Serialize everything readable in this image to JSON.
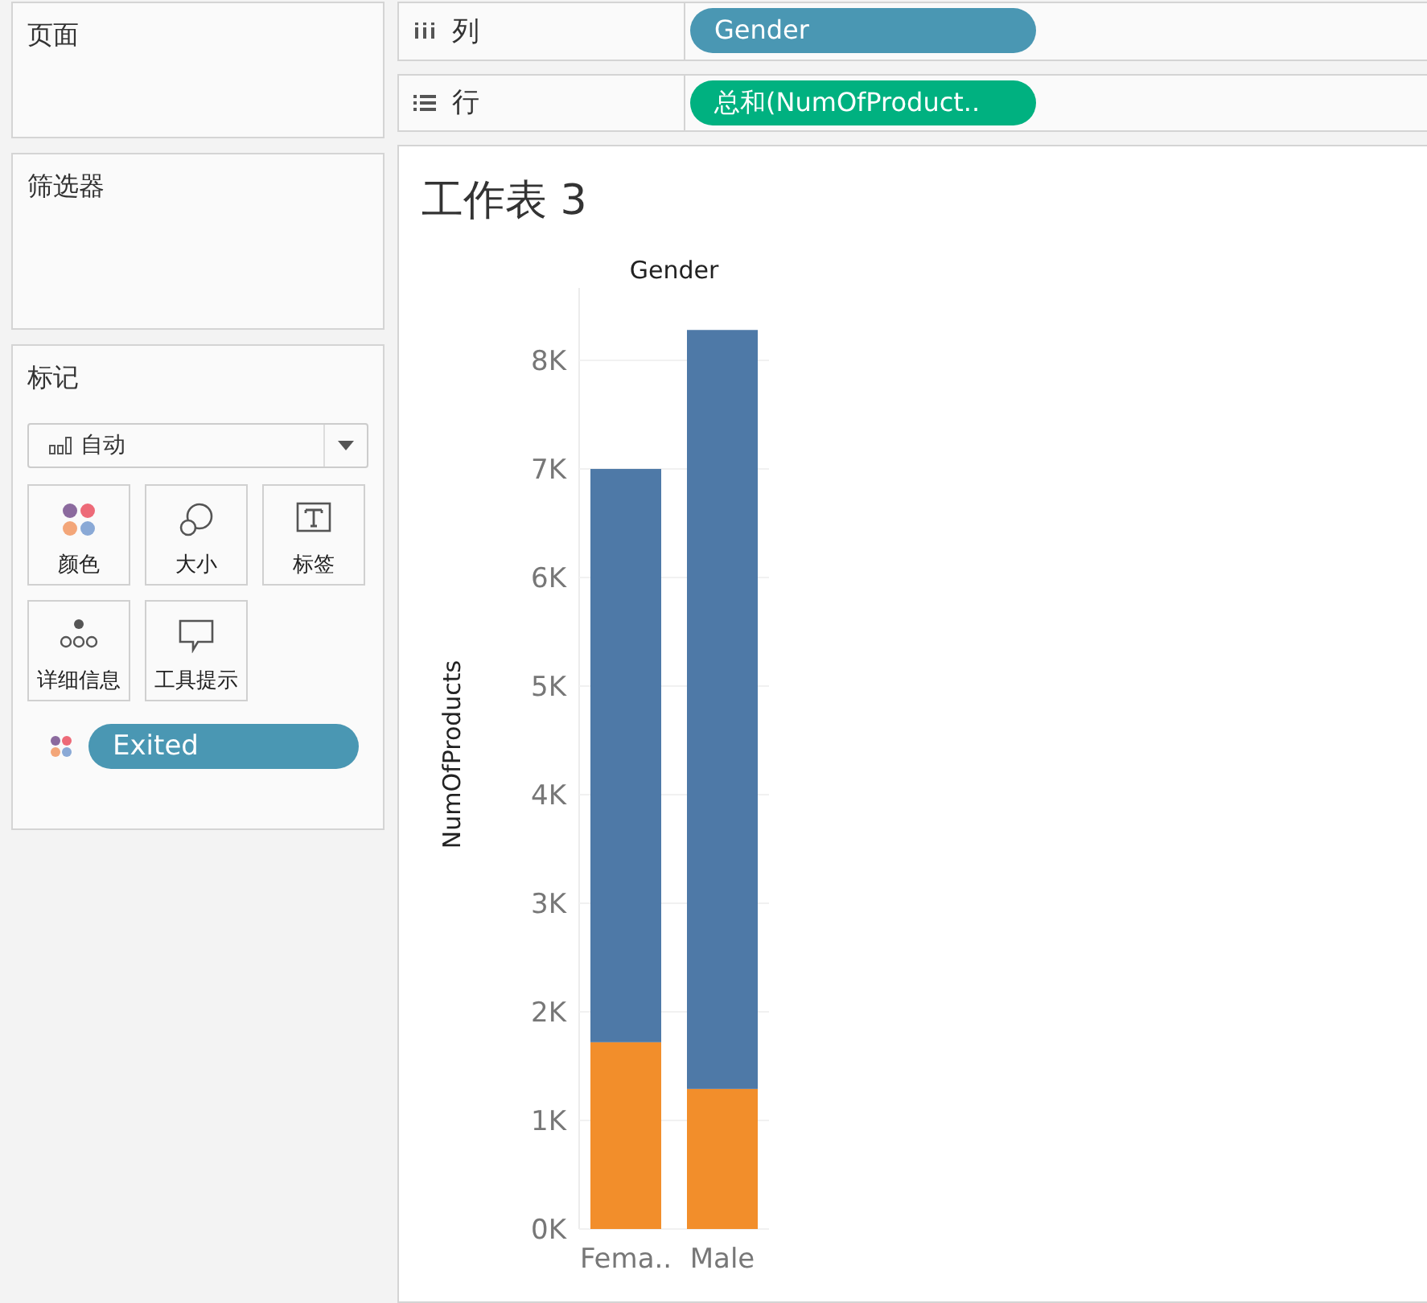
{
  "pages_card": {
    "title": "页面"
  },
  "filters_card": {
    "title": "筛选器"
  },
  "marks_card": {
    "title": "标记",
    "mark_type": "自动",
    "buttons": [
      {
        "kind": "color",
        "label": "颜色"
      },
      {
        "kind": "size",
        "label": "大小"
      },
      {
        "kind": "label",
        "label": "标签"
      },
      {
        "kind": "detail",
        "label": "详细信息"
      },
      {
        "kind": "tooltip",
        "label": "工具提示"
      }
    ],
    "fields": [
      {
        "kind": "color",
        "label": "Exited",
        "color": "#4a97b3"
      }
    ]
  },
  "shelves": [
    {
      "kind": "columns",
      "label": "列",
      "pill": "Gender",
      "color": "#4a97b3"
    },
    {
      "kind": "rows",
      "label": "行",
      "pill": "总和(NumOfProduct..",
      "color": "#00b180"
    }
  ],
  "worksheet": {
    "title": "工作表 3",
    "header": "Gender",
    "chart_data": {
      "type": "bar",
      "stacked": true,
      "ylabel": "NumOfProducts",
      "categories": [
        "Fema..",
        "Male"
      ],
      "series": [
        {
          "color": "#f28e2b",
          "values": [
            1720,
            1290
          ]
        },
        {
          "color": "#4e79a7",
          "values": [
            5280,
            6990
          ]
        }
      ],
      "ylim": [
        0,
        8667
      ],
      "grid": true,
      "yticks": [
        {
          "value": 0,
          "label": "0K"
        },
        {
          "value": 1000,
          "label": "1K"
        },
        {
          "value": 2000,
          "label": "2K"
        },
        {
          "value": 3000,
          "label": "3K"
        },
        {
          "value": 4000,
          "label": "4K"
        },
        {
          "value": 5000,
          "label": "5K"
        },
        {
          "value": 6000,
          "label": "6K"
        },
        {
          "value": 7000,
          "label": "7K"
        },
        {
          "value": 8000,
          "label": "8K"
        }
      ]
    }
  }
}
